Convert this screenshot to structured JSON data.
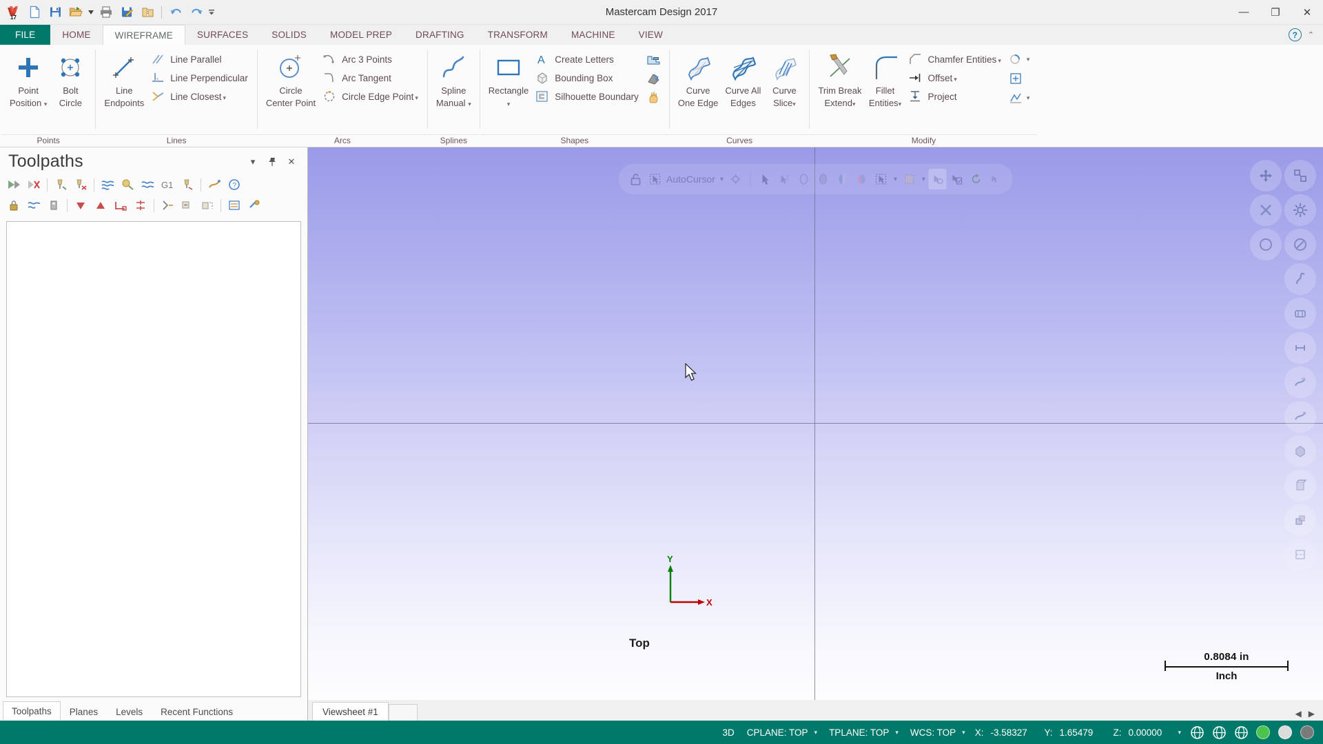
{
  "window": {
    "title": "Mastercam Design 2017",
    "minimize": "—",
    "maximize": "❐",
    "close": "✕"
  },
  "quick_access": {
    "items": [
      {
        "name": "app-logo-icon",
        "label": "Mastercam 17"
      },
      {
        "name": "new-file-icon",
        "label": "New"
      },
      {
        "name": "save-icon",
        "label": "Save"
      },
      {
        "name": "open-folder-icon",
        "label": "Open"
      },
      {
        "name": "open-dropdown-caret",
        "label": "▾"
      },
      {
        "name": "print-icon",
        "label": "Print"
      },
      {
        "name": "save-as-icon",
        "label": "Save As"
      },
      {
        "name": "zip2go-icon",
        "label": "Zip2Go"
      },
      {
        "name": "undo-icon",
        "label": "Undo"
      },
      {
        "name": "redo-icon",
        "label": "Redo"
      },
      {
        "name": "customize-qat-icon",
        "label": "▾"
      }
    ]
  },
  "ribbon_tabs": [
    {
      "label": "FILE",
      "active": false,
      "file": true
    },
    {
      "label": "HOME",
      "active": false,
      "file": false
    },
    {
      "label": "WIREFRAME",
      "active": true,
      "file": false
    },
    {
      "label": "SURFACES",
      "active": false,
      "file": false
    },
    {
      "label": "SOLIDS",
      "active": false,
      "file": false
    },
    {
      "label": "MODEL PREP",
      "active": false,
      "file": false
    },
    {
      "label": "DRAFTING",
      "active": false,
      "file": false
    },
    {
      "label": "TRANSFORM",
      "active": false,
      "file": false
    },
    {
      "label": "MACHINE",
      "active": false,
      "file": false
    },
    {
      "label": "VIEW",
      "active": false,
      "file": false
    }
  ],
  "ribbon_help": {
    "help_label": "?",
    "collapse_label": "⌃"
  },
  "ribbon_groups": [
    {
      "name": "points",
      "label": "Points",
      "big_buttons": [
        {
          "label_line1": "Point",
          "label_line2": "Position",
          "has_caret": true,
          "icon": "plus-point-icon"
        },
        {
          "label_line1": "Bolt",
          "label_line2": "Circle",
          "has_caret": false,
          "icon": "bolt-circle-icon"
        }
      ],
      "small_buttons": []
    },
    {
      "name": "lines",
      "label": "Lines",
      "big_buttons": [
        {
          "label_line1": "Line",
          "label_line2": "Endpoints",
          "has_caret": false,
          "icon": "line-endpoints-icon"
        }
      ],
      "small_buttons": [
        {
          "label": "Line Parallel",
          "has_caret": false,
          "icon": "line-parallel-icon"
        },
        {
          "label": "Line Perpendicular",
          "has_caret": false,
          "icon": "line-perpendicular-icon"
        },
        {
          "label": "Line Closest",
          "has_caret": true,
          "icon": "line-closest-icon"
        }
      ]
    },
    {
      "name": "arcs",
      "label": "Arcs",
      "big_buttons": [
        {
          "label_line1": "Circle",
          "label_line2": "Center Point",
          "has_caret": false,
          "icon": "circle-center-point-icon"
        }
      ],
      "small_buttons": [
        {
          "label": "Arc 3 Points",
          "has_caret": false,
          "icon": "arc-3-points-icon"
        },
        {
          "label": "Arc Tangent",
          "has_caret": false,
          "icon": "arc-tangent-icon"
        },
        {
          "label": "Circle Edge Point",
          "has_caret": true,
          "icon": "circle-edge-point-icon"
        }
      ]
    },
    {
      "name": "splines",
      "label": "Splines",
      "big_buttons": [
        {
          "label_line1": "Spline",
          "label_line2": "Manual",
          "has_caret": true,
          "icon": "spline-manual-icon"
        }
      ],
      "small_buttons": []
    },
    {
      "name": "shapes",
      "label": "Shapes",
      "big_buttons": [
        {
          "label_line1": "Rectangle",
          "label_line2": "",
          "has_caret": true,
          "icon": "rectangle-icon"
        }
      ],
      "small_buttons": [
        {
          "label": "Create Letters",
          "has_caret": false,
          "icon": "create-letters-icon"
        },
        {
          "label": "Bounding Box",
          "has_caret": false,
          "icon": "bounding-box-icon"
        },
        {
          "label": "Silhouette Boundary",
          "has_caret": false,
          "icon": "silhouette-boundary-icon"
        }
      ],
      "icon_only": [
        {
          "name": "stair-shape-icon"
        },
        {
          "name": "polygon-shape-icon"
        },
        {
          "name": "door-shape-icon"
        }
      ]
    },
    {
      "name": "curves",
      "label": "Curves",
      "big_buttons": [
        {
          "label_line1": "Curve",
          "label_line2": "One Edge",
          "has_caret": false,
          "icon": "curve-one-edge-icon"
        },
        {
          "label_line1": "Curve All",
          "label_line2": "Edges",
          "has_caret": false,
          "icon": "curve-all-edges-icon"
        },
        {
          "label_line1": "Curve",
          "label_line2": "Slice",
          "has_caret": true,
          "icon": "curve-slice-icon"
        }
      ],
      "small_buttons": []
    },
    {
      "name": "modify",
      "label": "Modify",
      "big_buttons": [
        {
          "label_line1": "Trim Break",
          "label_line2": "Extend",
          "has_caret": true,
          "icon": "trim-break-extend-icon"
        },
        {
          "label_line1": "Fillet",
          "label_line2": "Entities",
          "has_caret": true,
          "icon": "fillet-entities-icon"
        }
      ],
      "small_buttons": [
        {
          "label": "Chamfer Entities",
          "has_caret": true,
          "icon": "chamfer-entities-icon"
        },
        {
          "label": "Offset",
          "has_caret": true,
          "icon": "offset-icon"
        },
        {
          "label": "Project",
          "has_caret": false,
          "icon": "project-icon"
        }
      ],
      "icon_only": [
        {
          "name": "circle-modify-icon"
        },
        {
          "name": "add-frame-icon"
        },
        {
          "name": "trim-graph-icon"
        }
      ]
    }
  ],
  "toolpaths_panel": {
    "title": "Toolpaths",
    "header_buttons": [
      {
        "name": "panel-dropdown-caret",
        "label": "▾"
      },
      {
        "name": "panel-pin-icon",
        "label": "📌"
      },
      {
        "name": "panel-close-icon",
        "label": "✕"
      }
    ],
    "toolbar_row1": [
      {
        "name": "select-all-operations-icon"
      },
      {
        "name": "deselect-all-operations-icon"
      },
      {
        "name": "regenerate-selected-icon"
      },
      {
        "name": "regenerate-invalid-icon"
      },
      {
        "name": "simulate-toolpath-icon"
      },
      {
        "name": "verify-toolpath-icon"
      },
      {
        "name": "simulate-associative-icon"
      },
      {
        "name": "g1-backplot-icon",
        "label": "G1"
      },
      {
        "name": "post-selected-icon"
      },
      {
        "name": "high-speed-toolpath-icon"
      },
      {
        "name": "help-toolpath-icon"
      }
    ],
    "toolbar_row2": [
      {
        "name": "lock-toolpath-icon"
      },
      {
        "name": "toggle-posting-icon"
      },
      {
        "name": "toggle-toolpath-display-icon"
      },
      {
        "name": "move-down-icon"
      },
      {
        "name": "move-up-icon"
      },
      {
        "name": "toolpath-group-icon"
      },
      {
        "name": "single-selection-icon"
      },
      {
        "name": "expand-tree-icon"
      },
      {
        "name": "collapse-tree-icon"
      },
      {
        "name": "cut-operation-icon"
      },
      {
        "name": "paste-operation-icon"
      },
      {
        "name": "renumber-icon"
      },
      {
        "name": "settings-toolpath-icon"
      }
    ],
    "tree_items": []
  },
  "dock_tabs": [
    {
      "label": "Toolpaths",
      "active": true
    },
    {
      "label": "Planes",
      "active": false
    },
    {
      "label": "Levels",
      "active": false
    },
    {
      "label": "Recent Functions",
      "active": false
    }
  ],
  "autocursor_bar": {
    "lock_label": "",
    "label": "AutoCursor",
    "caret": "▾",
    "items": [
      {
        "name": "autocursor-lock-icon"
      },
      {
        "name": "autocursor-select-icon"
      },
      {
        "name": "autocursor-settings-icon"
      },
      {
        "name": "select-arrow-icon"
      },
      {
        "name": "select-wireframe-icon"
      },
      {
        "name": "select-face-icon"
      },
      {
        "name": "select-solid-icon"
      },
      {
        "name": "select-body-icon"
      },
      {
        "name": "select-shaded-icon"
      },
      {
        "name": "select-window-icon"
      },
      {
        "name": "select-mask-icon"
      },
      {
        "name": "select-previous-icon"
      },
      {
        "name": "select-verify-icon"
      },
      {
        "name": "select-refresh-icon"
      },
      {
        "name": "select-undo-icon"
      }
    ]
  },
  "viewport": {
    "view_name": "Top",
    "scale_value": "0.8084 in",
    "scale_unit": "Inch",
    "axis_x_label": "X",
    "axis_y_label": "Y"
  },
  "view_tools": [
    {
      "name": "fit-screen-icon"
    },
    {
      "name": "zoom-window-icon"
    },
    {
      "name": "zoom-target-icon"
    },
    {
      "name": "view-settings-icon"
    },
    {
      "name": "unzoom-icon"
    },
    {
      "name": "no-display-icon"
    },
    {
      "name": "dynamic-rotate-icon"
    },
    {
      "name": "pan-view-icon"
    },
    {
      "name": "measure-distance-icon"
    },
    {
      "name": "wireframe-shade-icon"
    },
    {
      "name": "shade-no-edges-icon"
    },
    {
      "name": "shaded-solid-icon"
    },
    {
      "name": "translucent-shade-icon"
    },
    {
      "name": "material-shade-icon"
    },
    {
      "name": "section-view-icon"
    }
  ],
  "sheet_bar": {
    "tabs": [
      {
        "label": "Viewsheet #1",
        "active": true
      }
    ],
    "add_label": "",
    "nav": [
      "◀",
      "▶"
    ]
  },
  "status_bar": {
    "mode_label": "3D",
    "cplane": "CPLANE: TOP",
    "tplane": "TPLANE: TOP",
    "wcs": "WCS: TOP",
    "caret": "▾",
    "coords": [
      {
        "label": "X:",
        "value": "-3.58327"
      },
      {
        "label": "Y:",
        "value": "1.65479"
      },
      {
        "label": "Z:",
        "value": "0.00000"
      }
    ],
    "right_icons": [
      {
        "name": "globe-wcs-icon"
      },
      {
        "name": "globe-cplane-icon"
      },
      {
        "name": "globe-tplane-icon"
      }
    ],
    "color_swatches": [
      "#4cc34c",
      "#dcdcdc",
      "#7a7a7a"
    ]
  },
  "colors": {
    "brand_teal": "#00796b",
    "ribbon_label": "#6b5361",
    "accent_blue": "#2e75b6",
    "axis_x": "#c00000",
    "axis_y": "#008000"
  }
}
